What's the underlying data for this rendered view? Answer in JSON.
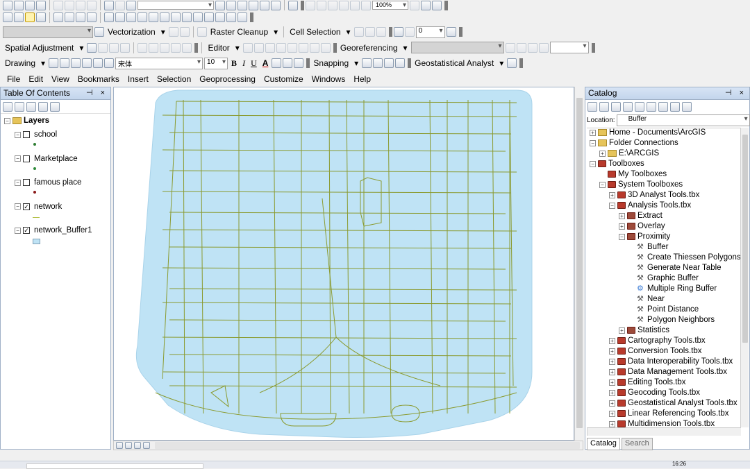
{
  "toolbars": {
    "zoom_percent": "100%",
    "vectorization_label": "Vectorization",
    "raster_cleanup_label": "Raster Cleanup",
    "cell_selection_label": "Cell Selection",
    "zero_value": "0",
    "spatial_adjustment_label": "Spatial Adjustment",
    "editor_label": "Editor",
    "georeferencing_label": "Georeferencing",
    "drawing_label": "Drawing",
    "font_name": "宋体",
    "font_size": "10",
    "bold": "B",
    "italic": "I",
    "underline": "U",
    "font_color_letter": "A",
    "snapping_label": "Snapping",
    "geostat_label": "Geostatistical Analyst"
  },
  "menu": [
    "File",
    "Edit",
    "View",
    "Bookmarks",
    "Insert",
    "Selection",
    "Geoprocessing",
    "Customize",
    "Windows",
    "Help"
  ],
  "toc": {
    "title": "Table Of Contents",
    "controls": "⊣ ×",
    "root": "Layers",
    "layers": [
      {
        "name": "school",
        "checked": false,
        "symbol_color": "#2e7d32"
      },
      {
        "name": "Marketplace",
        "checked": false,
        "symbol_color": "#2e8b3a"
      },
      {
        "name": "famous place",
        "checked": false,
        "symbol_color": "#8b1a1a"
      },
      {
        "name": "network",
        "checked": true,
        "symbol_color": "#b5c24a"
      },
      {
        "name": "network_Buffer1",
        "checked": true,
        "symbol_color": "#bfe3f5"
      }
    ]
  },
  "map": {
    "buffer_color": "#bfe3f5",
    "road_color": "#8a9a2e"
  },
  "catalog": {
    "title": "Catalog",
    "controls": "⊣ ×",
    "location_label": "Location:",
    "location_value": "Buffer",
    "items": [
      {
        "text": "Home - Documents\\ArcGIS",
        "level": 0,
        "exp": "+",
        "icon": "folder"
      },
      {
        "text": "Folder Connections",
        "level": 0,
        "exp": "-",
        "icon": "folder"
      },
      {
        "text": "E:\\ARCGIS",
        "level": 1,
        "exp": "+",
        "icon": "folder"
      },
      {
        "text": "Toolboxes",
        "level": 0,
        "exp": "-",
        "icon": "toolbox"
      },
      {
        "text": "My Toolboxes",
        "level": 1,
        "exp": "",
        "icon": "toolbox"
      },
      {
        "text": "System Toolboxes",
        "level": 1,
        "exp": "-",
        "icon": "toolbox"
      },
      {
        "text": "3D Analyst Tools.tbx",
        "level": 2,
        "exp": "+",
        "icon": "toolbox"
      },
      {
        "text": "Analysis Tools.tbx",
        "level": 2,
        "exp": "-",
        "icon": "toolbox"
      },
      {
        "text": "Extract",
        "level": 3,
        "exp": "+",
        "icon": "toolset"
      },
      {
        "text": "Overlay",
        "level": 3,
        "exp": "+",
        "icon": "toolset"
      },
      {
        "text": "Proximity",
        "level": 3,
        "exp": "-",
        "icon": "toolset"
      },
      {
        "text": "Buffer",
        "level": 4,
        "exp": "",
        "icon": "tool"
      },
      {
        "text": "Create Thiessen Polygons",
        "level": 4,
        "exp": "",
        "icon": "tool"
      },
      {
        "text": "Generate Near Table",
        "level": 4,
        "exp": "",
        "icon": "tool"
      },
      {
        "text": "Graphic Buffer",
        "level": 4,
        "exp": "",
        "icon": "tool"
      },
      {
        "text": "Multiple Ring Buffer",
        "level": 4,
        "exp": "",
        "icon": "script"
      },
      {
        "text": "Near",
        "level": 4,
        "exp": "",
        "icon": "tool"
      },
      {
        "text": "Point Distance",
        "level": 4,
        "exp": "",
        "icon": "tool"
      },
      {
        "text": "Polygon Neighbors",
        "level": 4,
        "exp": "",
        "icon": "tool"
      },
      {
        "text": "Statistics",
        "level": 3,
        "exp": "+",
        "icon": "toolset"
      },
      {
        "text": "Cartography Tools.tbx",
        "level": 2,
        "exp": "+",
        "icon": "toolbox"
      },
      {
        "text": "Conversion Tools.tbx",
        "level": 2,
        "exp": "+",
        "icon": "toolbox"
      },
      {
        "text": "Data Interoperability Tools.tbx",
        "level": 2,
        "exp": "+",
        "icon": "toolbox"
      },
      {
        "text": "Data Management Tools.tbx",
        "level": 2,
        "exp": "+",
        "icon": "toolbox"
      },
      {
        "text": "Editing Tools.tbx",
        "level": 2,
        "exp": "+",
        "icon": "toolbox"
      },
      {
        "text": "Geocoding Tools.tbx",
        "level": 2,
        "exp": "+",
        "icon": "toolbox"
      },
      {
        "text": "Geostatistical Analyst Tools.tbx",
        "level": 2,
        "exp": "+",
        "icon": "toolbox"
      },
      {
        "text": "Linear Referencing Tools.tbx",
        "level": 2,
        "exp": "+",
        "icon": "toolbox"
      },
      {
        "text": "Multidimension Tools.tbx",
        "level": 2,
        "exp": "+",
        "icon": "toolbox"
      }
    ],
    "tabs": [
      "Catalog",
      "Search"
    ]
  },
  "taskbar": {
    "clock": "16:26"
  }
}
